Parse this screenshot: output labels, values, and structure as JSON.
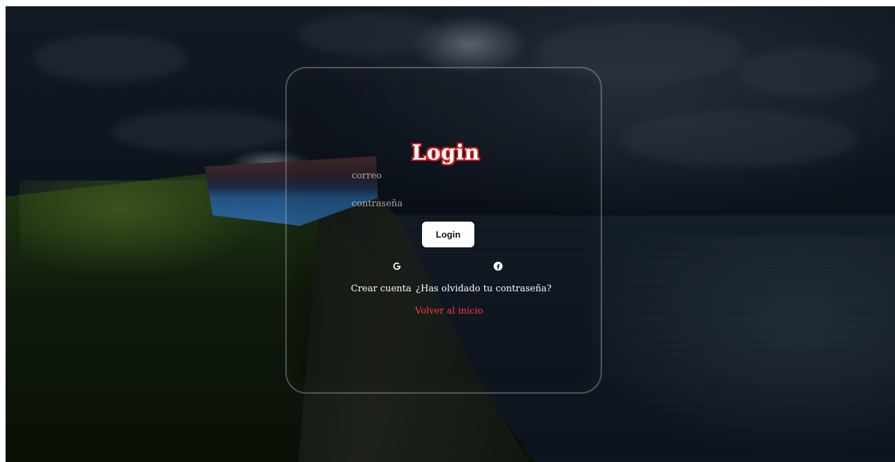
{
  "login": {
    "title": "Login",
    "email_placeholder": "correo",
    "password_placeholder": "contraseña",
    "submit_label": "Login",
    "social": [
      {
        "name": "google",
        "icon": "google-icon"
      },
      {
        "name": "facebook",
        "icon": "facebook-icon"
      }
    ],
    "create_account": "Crear cuenta",
    "forgot_password": "¿Has olvidado tu contraseña?",
    "back_home": "Volver al inicio"
  },
  "colors": {
    "accent": "#c81e1e",
    "link_red": "#ff3b3b",
    "button_bg": "#ffffff"
  }
}
